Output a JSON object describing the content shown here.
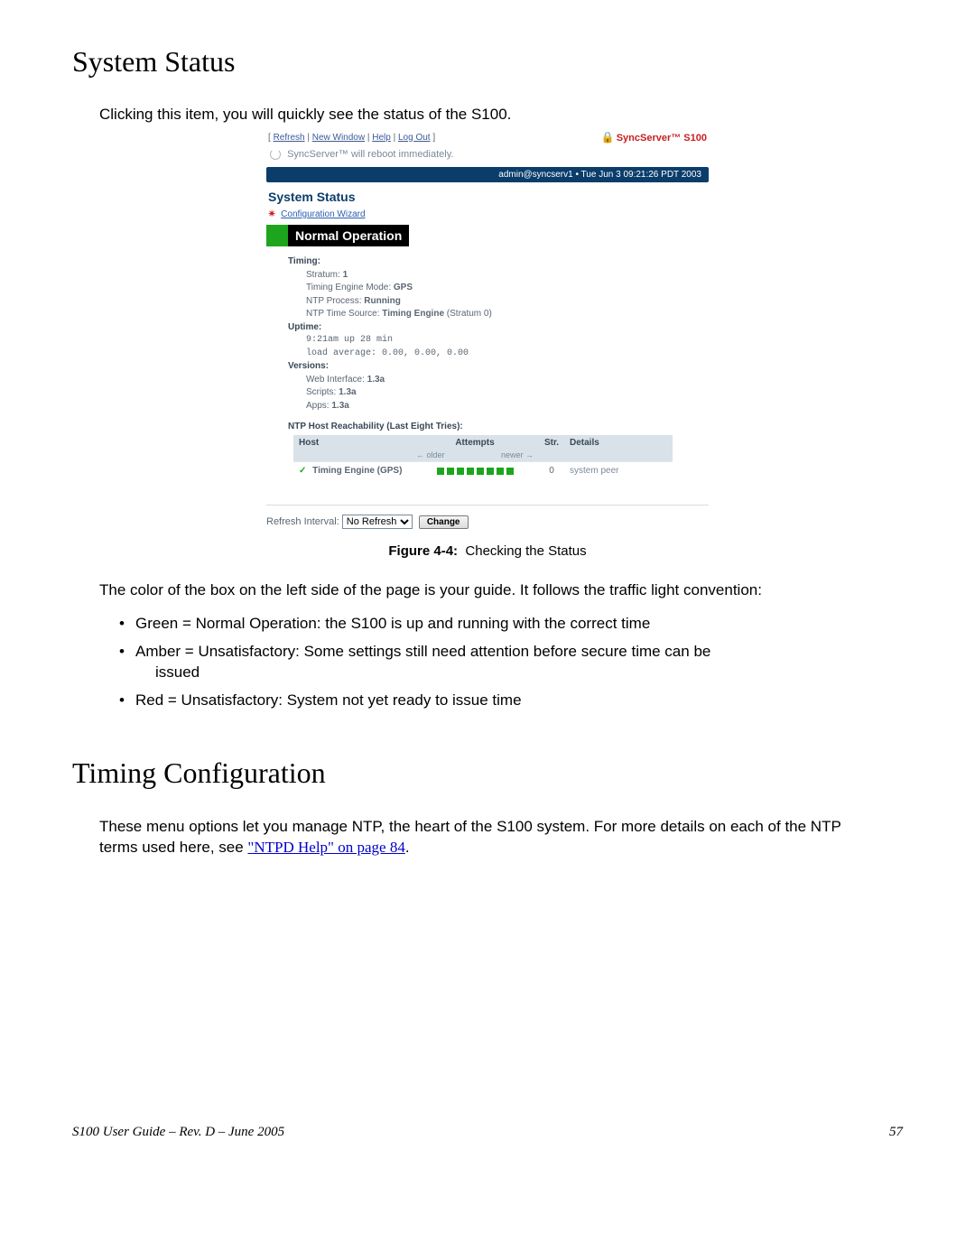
{
  "section1": {
    "title": "System Status",
    "intro": "Clicking this item, you will quickly see the status of the S100."
  },
  "screenshot": {
    "top_links": {
      "refresh": "Refresh",
      "new_window": "New Window",
      "help": "Help",
      "log_out": "Log Out"
    },
    "logo": "SyncServer™ S100",
    "reboot_msg": "SyncServer™ will reboot immediately.",
    "banner": "admin@syncserv1 • Tue Jun 3 09:21:26 PDT 2003",
    "status_title": "System Status",
    "config_wizard": "Configuration Wizard",
    "normal_op": "Normal Operation",
    "timing": {
      "label": "Timing:",
      "stratum_lbl": "Stratum:",
      "stratum_val": "1",
      "engine_lbl": "Timing Engine Mode:",
      "engine_val": "GPS",
      "ntpproc_lbl": "NTP Process:",
      "ntpproc_val": "Running",
      "ntpsrc_lbl": "NTP Time Source:",
      "ntpsrc_val": "Timing Engine",
      "ntpsrc_paren": "(Stratum 0)"
    },
    "uptime": {
      "label": "Uptime:",
      "line1": "9:21am up 28 min",
      "line2": "load average: 0.00, 0.00, 0.00"
    },
    "versions": {
      "label": "Versions:",
      "web_lbl": "Web Interface:",
      "web_val": "1.3a",
      "scripts_lbl": "Scripts:",
      "scripts_val": "1.3a",
      "apps_lbl": "Apps:",
      "apps_val": "1.3a"
    },
    "reach_title": "NTP Host Reachability (Last Eight Tries):",
    "table": {
      "h_host": "Host",
      "h_attempts": "Attempts",
      "h_str": "Str.",
      "h_details": "Details",
      "older": "← older",
      "newer": "newer →",
      "row_host": "Timing Engine (GPS)",
      "row_str": "0",
      "row_det": "system peer"
    },
    "refresh_lbl": "Refresh Interval:",
    "refresh_opt": "No Refresh",
    "change_btn": "Change"
  },
  "figure": {
    "label": "Figure 4-4:",
    "caption": "Checking the Status"
  },
  "para_guide": "The color of the box on the left side of the page is your guide. It follows the traffic light convention:",
  "bullets": {
    "b1": "Green = Normal Operation: the S100 is up and running with the correct time",
    "b2a": "Amber = Unsatisfactory: Some settings still need attention before secure time can be",
    "b2b": "issued",
    "b3": "Red = Unsatisfactory: System not yet ready to issue time"
  },
  "section2": {
    "title": "Timing Configuration",
    "para_a": "These menu options let you manage NTP, the heart of the S100 system. For more details on each of the NTP terms used here, see ",
    "link": "\"NTPD Help\" on page 84",
    "para_b": "."
  },
  "footer": {
    "left": "S100 User Guide – Rev. D – June 2005",
    "right": "57"
  }
}
